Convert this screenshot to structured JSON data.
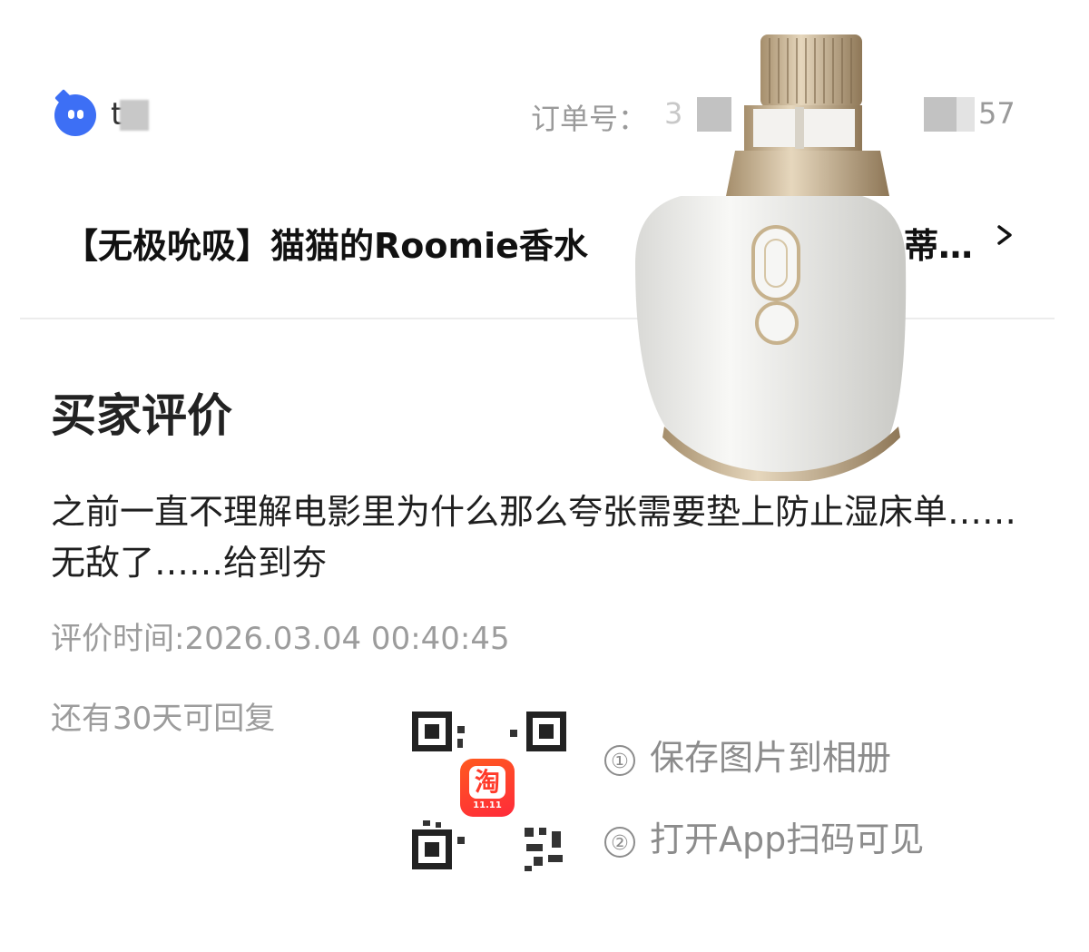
{
  "header": {
    "shop_name": "t",
    "order_label": "订单号：",
    "order_prefix": "3",
    "order_suffix": "57"
  },
  "product": {
    "title_left": "【无极吮吸】猫猫的Roomie香水",
    "title_right": "蒂…"
  },
  "review": {
    "section_title": "买家评价",
    "text": "之前一直不理解电影里为什么那么夸张需要垫上防止湿床单……无敌了……给到夯",
    "time": "评价时间:2026.03.04 00:40:45",
    "reply_remaining": "还有30天可回复"
  },
  "qr": {
    "app_icon_char": "淘",
    "app_icon_sub": "11.11",
    "step1_num": "①",
    "step1": "保存图片到相册",
    "step2_num": "②",
    "step2": "打开App扫码可见"
  },
  "colors": {
    "avatar": "#3d6ff5",
    "muted_text": "#9c9c9c",
    "taobao_orange": "#ff5a1f"
  },
  "icons": {
    "avatar": "chat-bubble-face-icon",
    "chevron": "chevron-right-icon",
    "app": "taobao-app-icon"
  }
}
